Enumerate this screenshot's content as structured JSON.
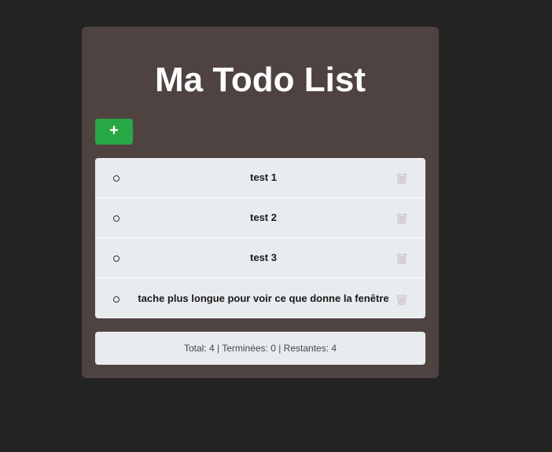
{
  "app": {
    "title": "Ma Todo List",
    "add_button_label": "+"
  },
  "todos": [
    {
      "label": "test 1",
      "done": false,
      "delete_icon": "trash-icon"
    },
    {
      "label": "test 2",
      "done": false,
      "delete_icon": "trash-icon"
    },
    {
      "label": "test 3",
      "done": false,
      "delete_icon": "trash-icon"
    },
    {
      "label": "tache plus longue pour voir ce que donne la fenêtre",
      "done": false,
      "delete_icon": "trash-icon"
    }
  ],
  "footer": {
    "summary": "Total: 4 | Terminées: 0 | Restantes: 4"
  },
  "colors": {
    "page_background": "#232323",
    "card_background": "#4f4342",
    "add_button": "#28a745",
    "list_background": "#e9ecef"
  }
}
